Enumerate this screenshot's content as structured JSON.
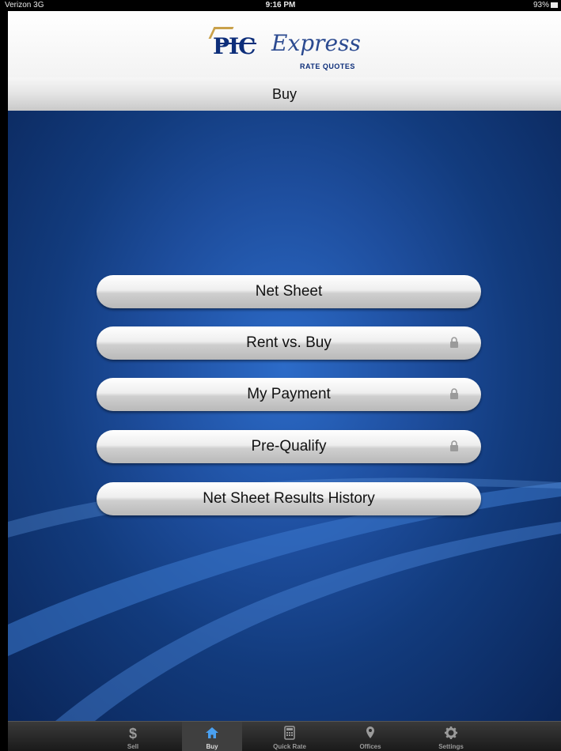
{
  "status_bar": {
    "carrier": "Verizon 3G",
    "time": "9:16 PM",
    "battery": "93%"
  },
  "header": {
    "logo_pic": "PIC",
    "logo_express": "Express",
    "logo_subtitle": "RATE QUOTES"
  },
  "title": "Buy",
  "menu": {
    "items": [
      {
        "label": "Net Sheet",
        "locked": false
      },
      {
        "label": "Rent vs. Buy",
        "locked": true
      },
      {
        "label": "My Payment",
        "locked": true
      },
      {
        "label": "Pre-Qualify",
        "locked": true
      },
      {
        "label": "Net Sheet Results History",
        "locked": false
      }
    ]
  },
  "tabbar": {
    "tabs": [
      {
        "label": "Sell",
        "icon": "dollar-icon",
        "active": false
      },
      {
        "label": "Buy",
        "icon": "home-icon",
        "active": true
      },
      {
        "label": "Quick Rate",
        "icon": "calculator-icon",
        "active": false
      },
      {
        "label": "Offices",
        "icon": "map-pin-icon",
        "active": false
      },
      {
        "label": "Settings",
        "icon": "gear-icon",
        "active": false
      }
    ]
  },
  "colors": {
    "brand_navy": "#0d2e7a",
    "background_blue": "#1e4e9e",
    "button_silver": "#d9d9d9"
  }
}
